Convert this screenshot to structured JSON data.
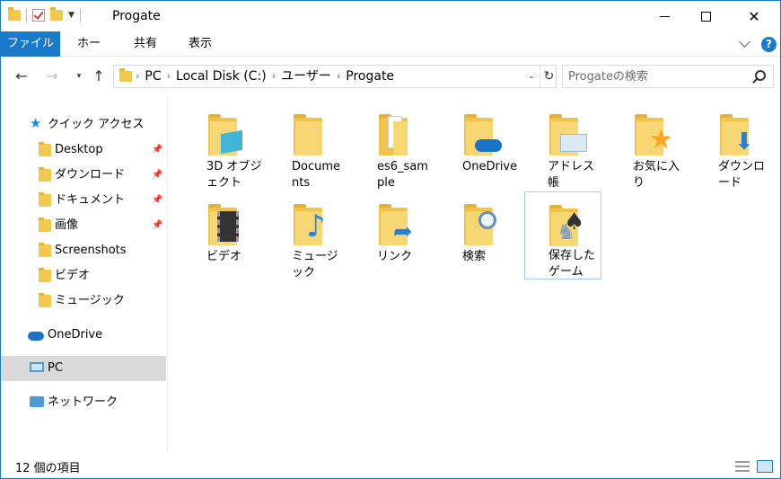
{
  "window": {
    "title": "Progate",
    "accent_color": "#1979ca"
  },
  "quick_access_toolbar": {
    "icons": [
      "folder-icon",
      "properties-check-icon",
      "new-folder-icon",
      "customize-dropdown-icon"
    ]
  },
  "window_controls": {
    "minimize": "minimize-icon",
    "maximize": "maximize-icon",
    "close": "✕"
  },
  "ribbon": {
    "tabs": [
      {
        "label": "ファイル",
        "active": true
      },
      {
        "label": "ホーム"
      },
      {
        "label": "共有"
      },
      {
        "label": "表示"
      }
    ],
    "help_label": "?"
  },
  "nav": {
    "back": "←",
    "forward": "→",
    "recent": "▾",
    "up": "↑"
  },
  "address": {
    "breadcrumbs": [
      "PC",
      "Local Disk (C:)",
      "ユーザー",
      "Progate"
    ],
    "separator": "›",
    "refresh": "↻",
    "dropdown": "⌄"
  },
  "search": {
    "placeholder": "Progateの検索"
  },
  "sidebar": {
    "items": [
      {
        "label": "クイック アクセス",
        "icon": "star-icon"
      },
      {
        "label": "Desktop",
        "icon": "desktop-folder-icon",
        "pinned": true
      },
      {
        "label": "ダウンロード",
        "icon": "downloads-folder-icon",
        "pinned": true
      },
      {
        "label": "ドキュメント",
        "icon": "documents-folder-icon",
        "pinned": true
      },
      {
        "label": "画像",
        "icon": "pictures-folder-icon",
        "pinned": true
      },
      {
        "label": "Screenshots",
        "icon": "folder-icon"
      },
      {
        "label": "ビデオ",
        "icon": "videos-folder-icon"
      },
      {
        "label": "ミュージック",
        "icon": "music-folder-icon"
      },
      {
        "label": "OneDrive",
        "icon": "onedrive-cloud-icon"
      },
      {
        "label": "PC",
        "icon": "pc-icon",
        "selected": true
      },
      {
        "label": "ネットワーク",
        "icon": "network-icon"
      }
    ],
    "pin_glyph": "📌"
  },
  "content": {
    "items": [
      {
        "label": "3D オブジェクト",
        "icon": "3d-objects-folder-icon"
      },
      {
        "label": "Documents",
        "icon": "folder-icon"
      },
      {
        "label": "es6_sample",
        "icon": "folder-with-files-icon"
      },
      {
        "label": "OneDrive",
        "icon": "onedrive-folder-icon"
      },
      {
        "label": "アドレス帳",
        "icon": "contacts-folder-icon"
      },
      {
        "label": "お気に入り",
        "icon": "favorites-folder-icon"
      },
      {
        "label": "ダウンロード",
        "icon": "downloads-folder-icon"
      },
      {
        "label": "ビデオ",
        "icon": "videos-folder-icon"
      },
      {
        "label": "ミュージック",
        "icon": "music-folder-icon"
      },
      {
        "label": "リンク",
        "icon": "links-folder-icon"
      },
      {
        "label": "検索",
        "icon": "searches-folder-icon"
      },
      {
        "label": "保存したゲーム",
        "icon": "saved-games-folder-icon",
        "selected": true
      }
    ]
  },
  "status": {
    "item_count": "12 個の項目"
  }
}
